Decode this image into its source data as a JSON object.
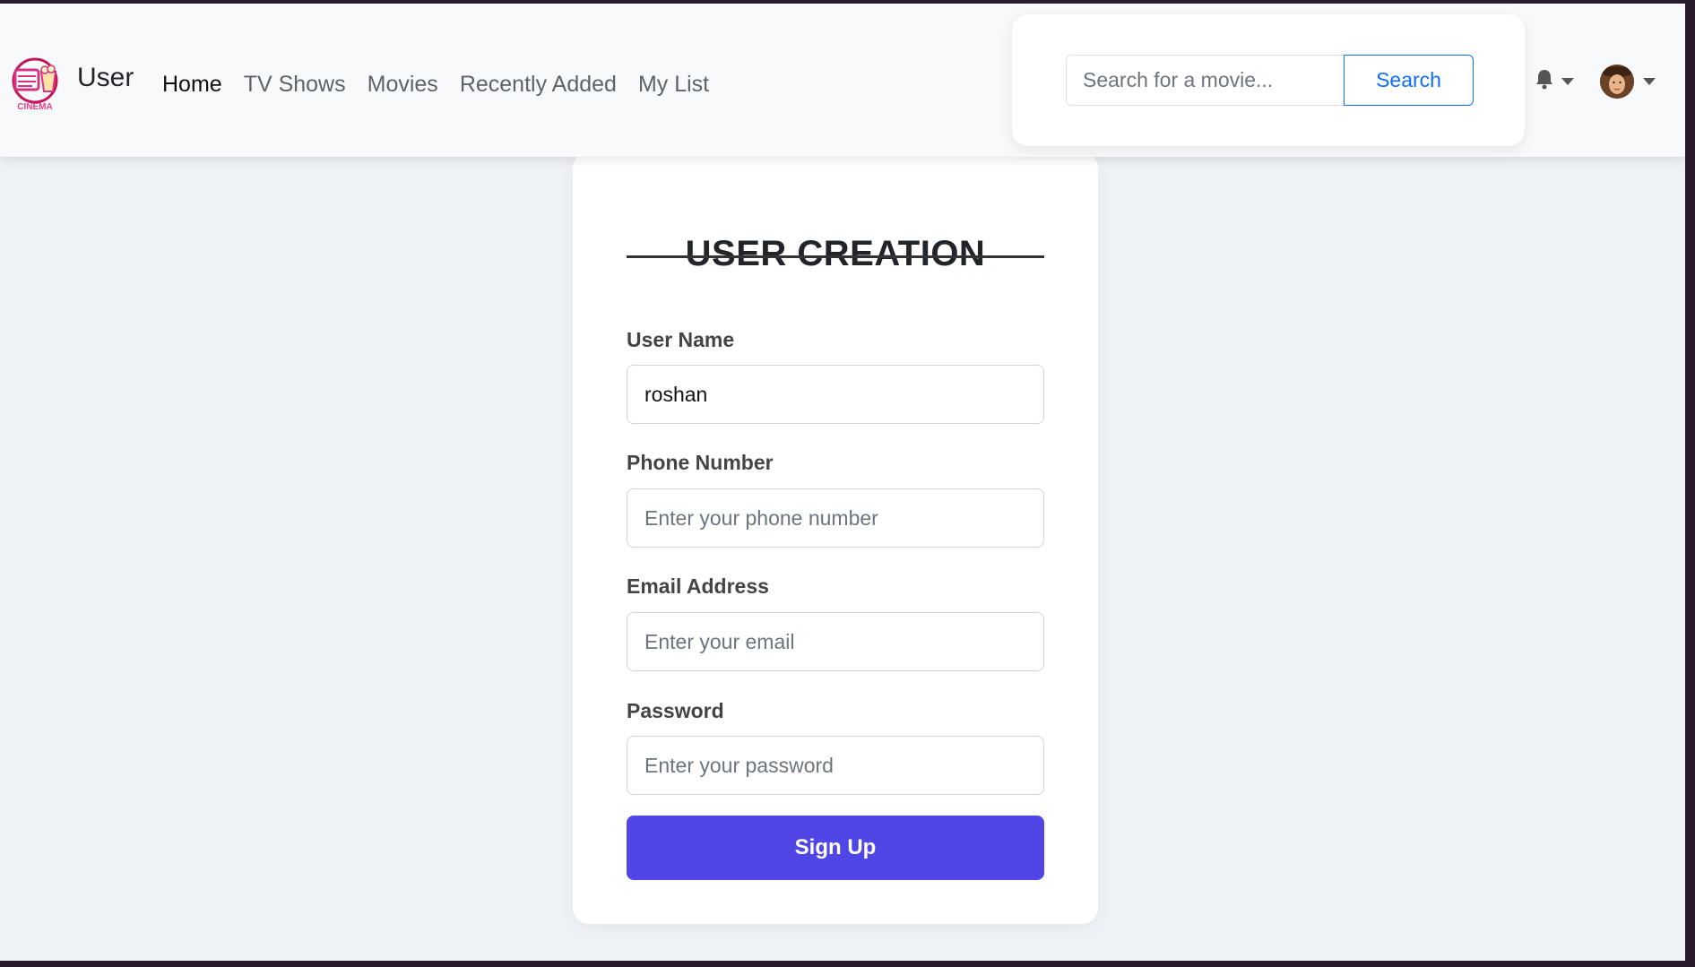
{
  "navbar": {
    "brand": "User",
    "logo_text": "CINEMA",
    "links": [
      {
        "label": "Home",
        "active": true
      },
      {
        "label": "TV Shows",
        "active": false
      },
      {
        "label": "Movies",
        "active": false
      },
      {
        "label": "Recently Added",
        "active": false
      },
      {
        "label": "My List",
        "active": false
      }
    ],
    "search": {
      "placeholder": "Search for a movie...",
      "button_label": "Search"
    },
    "icons": {
      "notifications": "bell-icon",
      "profile": "avatar"
    }
  },
  "form": {
    "title": "USER CREATION",
    "fields": [
      {
        "label": "User Name",
        "value": "roshan",
        "placeholder": ""
      },
      {
        "label": "Phone Number",
        "value": "",
        "placeholder": "Enter your phone number"
      },
      {
        "label": "Email Address",
        "value": "",
        "placeholder": "Enter your email"
      },
      {
        "label": "Password",
        "value": "",
        "placeholder": "Enter your password"
      }
    ],
    "submit_label": "Sign Up"
  },
  "colors": {
    "primary_button": "#4f46e5",
    "search_accent": "#0d6efd",
    "page_background": "#eff2f7",
    "logo_accent": "#d63384"
  }
}
